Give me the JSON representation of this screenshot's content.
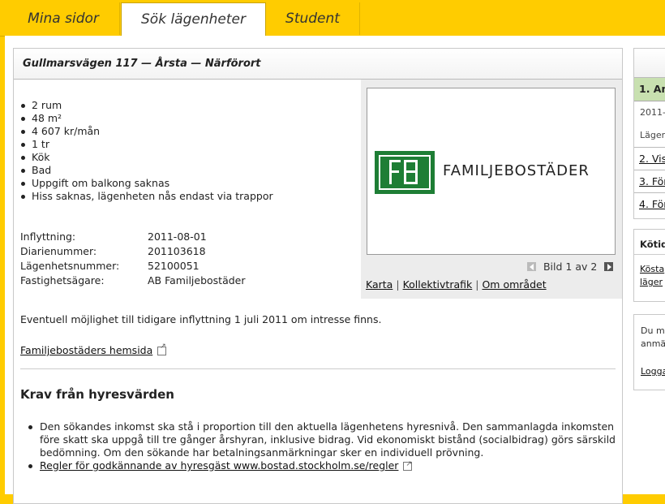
{
  "tabs": [
    {
      "label": "Mina sidor"
    },
    {
      "label": "Sök lägenheter"
    },
    {
      "label": "Student"
    }
  ],
  "listing": {
    "title": "Gullmarsvägen 117 — Årsta — Närförort",
    "features": [
      "2 rum",
      "48 m²",
      "4 607 kr/mån",
      "1 tr",
      "Kök",
      "Bad",
      "Uppgift om balkong saknas",
      "Hiss saknas, lägenheten nås endast via trappor"
    ],
    "info": [
      {
        "label": "Inflyttning:",
        "value": "2011-08-01"
      },
      {
        "label": "Diarienummer:",
        "value": "201103618"
      },
      {
        "label": "Lägenhetsnummer:",
        "value": "52100051"
      },
      {
        "label": "Fastighetsägare:",
        "value": "AB Familjebostäder"
      }
    ],
    "notice": "Eventuell möjlighet till tidigare inflyttning 1 juli 2011 om intresse finns.",
    "homepage_link": "Familjebostäders hemsida"
  },
  "gallery": {
    "logo_text": "FAMILJEBOSTÄDER",
    "logo_mark": "FB",
    "pager_text": "Bild 1 av 2",
    "links": [
      "Karta",
      "Kollektivtrafik",
      "Om området"
    ]
  },
  "requirements": {
    "heading": "Krav från hyresvärden",
    "item1": "Den sökandes inkomst ska stå i proportion till den aktuella lägenhetens hyresnivå. Den sammanlagda inkomsten före skatt ska uppgå till tre gånger årshyran, inklusive bidrag. Vid ekonomiskt bistånd (socialbidrag) görs särskild bedömning. Om den sökande har betalningsanmärkningar sker en individuell prövning.",
    "link": "Regler för godkännande av hyresgäst www.bostad.stockholm.se/regler"
  },
  "sidebar": {
    "step1": "1. Am",
    "step1_date": "2011-",
    "step1_sub": "Läger",
    "step2": "2. Vis",
    "step3": "3. För",
    "step4": "4. För",
    "box2_header": "Kötid",
    "box2_link1": "Kösta",
    "box2_link2": "läger",
    "box3_text1": "Du m",
    "box3_text2": "anmä",
    "box3_link": "Logga"
  },
  "colors": {
    "accent": "#ffcc00",
    "logo_green": "#1e7e35",
    "step_active": "#c8e0b0"
  }
}
